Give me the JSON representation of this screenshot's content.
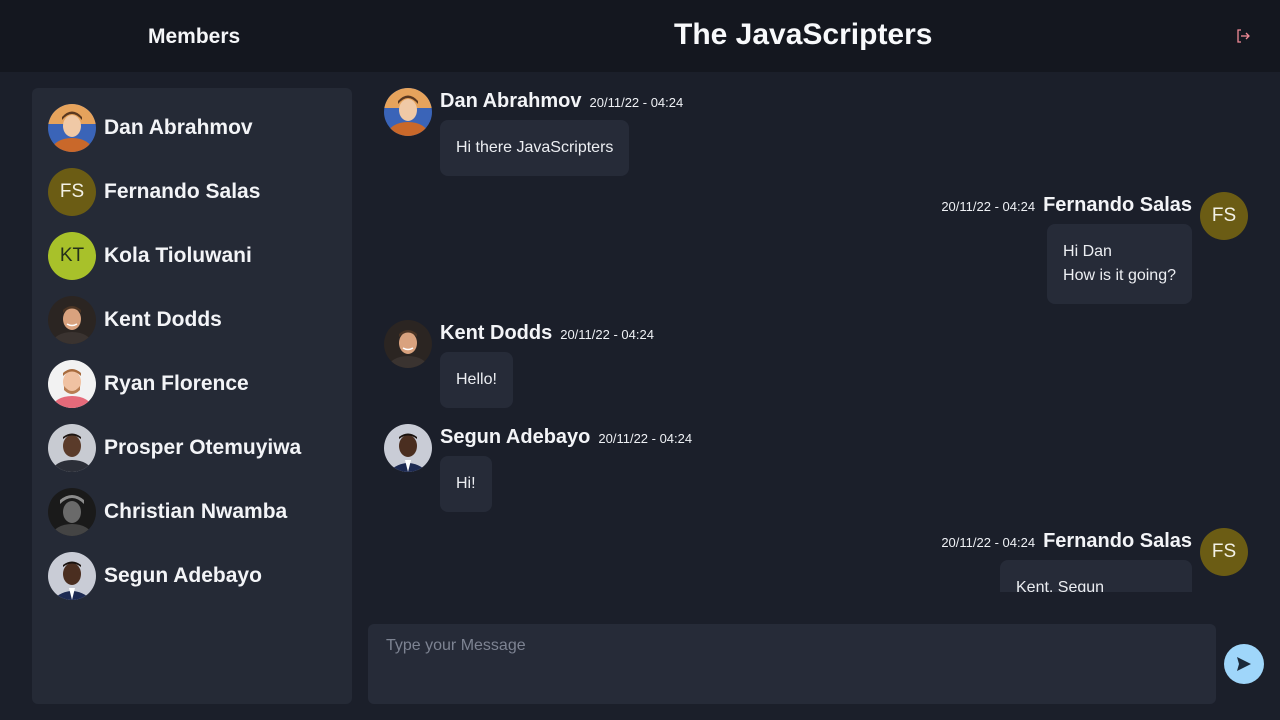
{
  "header": {
    "members_title": "Members",
    "room_title": "The JavaScripters",
    "logout_icon": "logout-icon"
  },
  "colors": {
    "background": "#1b1f2a",
    "topbar": "#14171f",
    "panel": "#252a36",
    "bubble": "#262b38",
    "send_button": "#9fd6fa",
    "logout_icon": "#f08a96",
    "initials_fs": "#6b5c14",
    "initials_kt": "#a8c12a"
  },
  "members": [
    {
      "name": "Dan Abrahmov",
      "avatar": "photo"
    },
    {
      "name": "Fernando Salas",
      "avatar": "initials",
      "initials": "FS"
    },
    {
      "name": "Kola Tioluwani",
      "avatar": "initials",
      "initials": "KT"
    },
    {
      "name": "Kent Dodds",
      "avatar": "photo"
    },
    {
      "name": "Ryan Florence",
      "avatar": "photo"
    },
    {
      "name": "Prosper Otemuyiwa",
      "avatar": "photo"
    },
    {
      "name": "Christian Nwamba",
      "avatar": "photo"
    },
    {
      "name": "Segun Adebayo",
      "avatar": "photo"
    }
  ],
  "messages": [
    {
      "sender": "Dan Abrahmov",
      "time": "20/11/22 - 04:24",
      "text": "Hi there JavaScripters",
      "side": "left"
    },
    {
      "sender": "Fernando Salas",
      "time": "20/11/22 - 04:24",
      "initials": "FS",
      "lines": [
        "Hi Dan",
        "How is it going?"
      ],
      "side": "right"
    },
    {
      "sender": "Kent Dodds",
      "time": "20/11/22 - 04:24",
      "text": "Hello!",
      "side": "left"
    },
    {
      "sender": "Segun Adebayo",
      "time": "20/11/22 - 04:24",
      "text": "Hi!",
      "side": "left"
    },
    {
      "sender": "Fernando Salas",
      "time": "20/11/22 - 04:24",
      "initials": "FS",
      "text": "Kent, Segun",
      "side": "right"
    }
  ],
  "composer": {
    "placeholder": "Type your Message",
    "value": "",
    "send_icon": "send-icon"
  }
}
